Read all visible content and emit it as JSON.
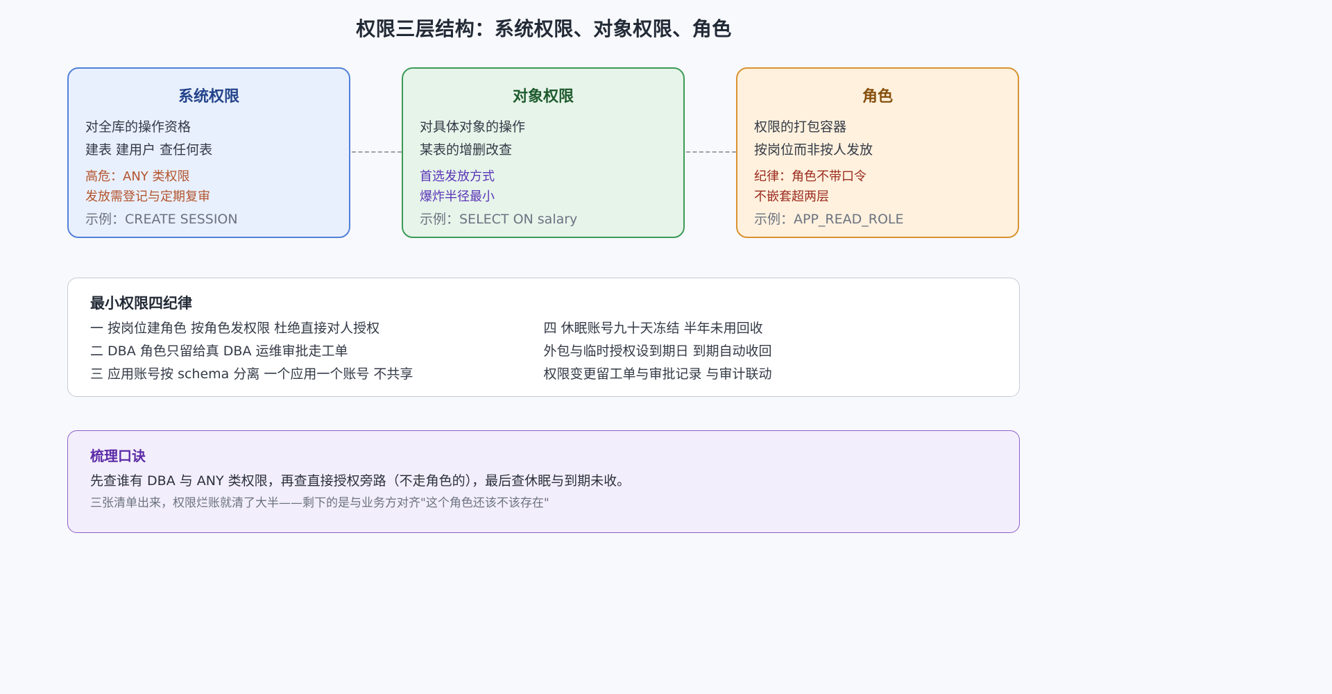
{
  "title": "权限三层结构：系统权限、对象权限、角色",
  "cards": [
    {
      "title": "系统权限",
      "lines": [
        "对全库的操作资格",
        "建表 建用户 查任何表"
      ],
      "notes": [
        "高危：ANY 类权限",
        "发放需登记与定期复审"
      ],
      "example": "示例：CREATE SESSION"
    },
    {
      "title": "对象权限",
      "lines": [
        "对具体对象的操作",
        "某表的增删改查"
      ],
      "notes": [
        "首选发放方式",
        "爆炸半径最小"
      ],
      "example": "示例：SELECT ON salary"
    },
    {
      "title": "角色",
      "lines": [
        "权限的打包容器",
        "按岗位而非按人发放"
      ],
      "notes": [
        "纪律：角色不带口令",
        "不嵌套超两层"
      ],
      "example": "示例：APP_READ_ROLE"
    }
  ],
  "rules": {
    "title": "最小权限四纪律",
    "left": [
      "一 按岗位建角色 按角色发权限 杜绝直接对人授权",
      "二 DBA 角色只留给真 DBA 运维审批走工单",
      "三 应用账号按 schema 分离 一个应用一个账号 不共享"
    ],
    "right": [
      "四 休眠账号九十天冻结 半年未用回收",
      "外包与临时授权设到期日 到期自动收回",
      "权限变更留工单与审批记录 与审计联动"
    ]
  },
  "mnemonic": {
    "title": "梳理口诀",
    "main": "先查谁有 DBA 与 ANY 类权限，再查直接授权旁路（不走角色的），最后查休眠与到期未收。",
    "sub": "三张清单出来，权限烂账就清了大半——剩下的是与业务方对齐\"这个角色还该不该存在\""
  }
}
